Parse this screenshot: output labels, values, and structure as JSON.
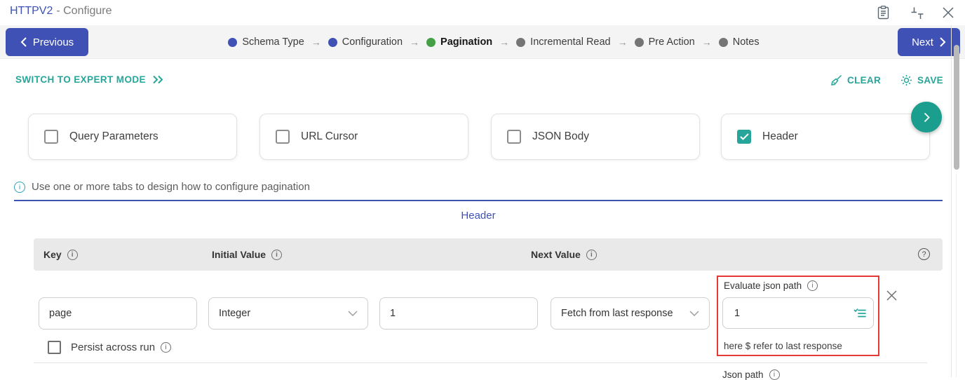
{
  "window": {
    "title": "HTTPV2",
    "subtitle": "- Configure",
    "icons": [
      "clipboard-icon",
      "collapse-icon",
      "close-icon"
    ]
  },
  "wizard": {
    "previous_label": "Previous",
    "next_label": "Next",
    "steps": [
      {
        "label": "Schema Type",
        "state": "done"
      },
      {
        "label": "Configuration",
        "state": "done"
      },
      {
        "label": "Pagination",
        "state": "active"
      },
      {
        "label": "Incremental Read",
        "state": "pending"
      },
      {
        "label": "Pre Action",
        "state": "pending"
      },
      {
        "label": "Notes",
        "state": "pending"
      }
    ]
  },
  "toolbar": {
    "expert_mode_label": "SWITCH TO EXPERT MODE",
    "clear_label": "CLEAR",
    "save_label": "SAVE"
  },
  "pagination_tabs": [
    {
      "label": "Query Parameters",
      "checked": false
    },
    {
      "label": "URL Cursor",
      "checked": false
    },
    {
      "label": "JSON Body",
      "checked": false
    },
    {
      "label": "Header",
      "checked": true
    }
  ],
  "info_banner": "Use one or more tabs to design how to configure pagination",
  "active_tab_label": "Header",
  "table": {
    "columns": [
      {
        "label": "Key"
      },
      {
        "label": "Initial Value"
      },
      {
        "label": "Next Value"
      }
    ],
    "rows": [
      {
        "key": "page",
        "initial_value_type": "Integer",
        "initial_value": "1",
        "next_value_mode": "Fetch from last response",
        "evaluate_json_path_label": "Evaluate json path",
        "evaluate_json_path_value": "1",
        "hint": "here $ refer to last response",
        "persist_label": "Persist across run"
      }
    ],
    "next_row_partial_label": "Json path"
  },
  "colors": {
    "primary_indigo": "#3F51B5",
    "teal_accent": "#26A69A",
    "fab_teal": "#1B9E8E",
    "active_step_green": "#43A047",
    "pending_step_gray": "#757575",
    "highlight_red": "#E53935",
    "table_header_bg": "#E9E9E9"
  }
}
